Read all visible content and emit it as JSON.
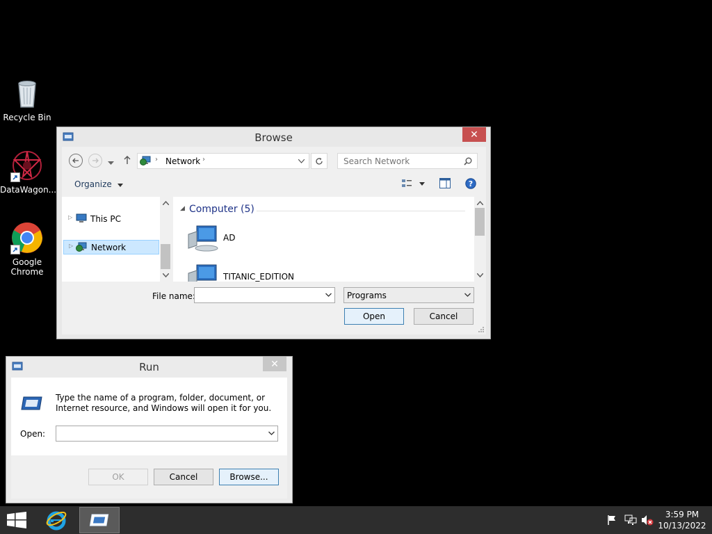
{
  "desktop": {
    "icons": [
      {
        "label": "Recycle Bin",
        "icon": "recycle-bin-icon"
      },
      {
        "label": "DataWagon...",
        "icon": "datawagon-icon"
      },
      {
        "label": "Google Chrome",
        "icon": "chrome-icon"
      }
    ]
  },
  "browse": {
    "title": "Browse",
    "address": {
      "path_segment": "Network"
    },
    "search": {
      "placeholder": "Search Network"
    },
    "toolbar": {
      "organize": "Organize"
    },
    "nav": [
      {
        "label": "This PC"
      },
      {
        "label": "Network"
      }
    ],
    "group": {
      "header": "Computer (5)"
    },
    "items": [
      {
        "label": "AD"
      },
      {
        "label": "TITANIC_EDITION"
      }
    ],
    "filename_label": "File name:",
    "filename_value": "",
    "filetype": "Programs",
    "open_label": "Open",
    "cancel_label": "Cancel"
  },
  "run": {
    "title": "Run",
    "description": "Type the name of a program, folder, document, or Internet resource, and Windows will open it for you.",
    "open_label": "Open:",
    "open_value": "",
    "ok_label": "OK",
    "cancel_label": "Cancel",
    "browse_label": "Browse..."
  },
  "taskbar": {
    "time": "3:59 PM",
    "date": "10/13/2022"
  },
  "colors": {
    "accent": "#0078d7",
    "close_red": "#c75050",
    "taskbar": "#2d2d2d",
    "selection": "#cce8ff",
    "group_header": "#1e3287"
  }
}
